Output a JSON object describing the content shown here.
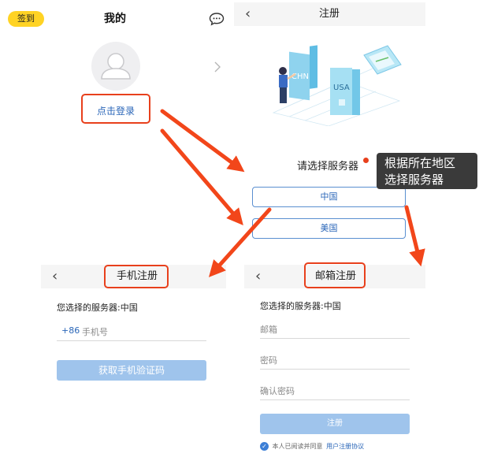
{
  "profile": {
    "signin_label": "签到",
    "title": "我的",
    "login_label": "点击登录"
  },
  "register": {
    "title": "注册",
    "prompt": "请选择服务器",
    "servers": [
      "中国",
      "美国"
    ],
    "illustration_labels": [
      "CHN",
      "USA"
    ]
  },
  "callout": {
    "line1": "根据所在地区",
    "line2": "选择服务器"
  },
  "phone_register": {
    "title": "手机注册",
    "server_text": "您选择的服务器:中国",
    "country_code": "+86",
    "phone_placeholder": "手机号",
    "get_code_label": "获取手机验证码"
  },
  "email_register": {
    "title": "邮箱注册",
    "server_text": "您选择的服务器:中国",
    "email_placeholder": "邮箱",
    "password_placeholder": "密码",
    "confirm_placeholder": "确认密码",
    "submit_label": "注册",
    "agree_text": "本人已阅读并同意",
    "agreement_link": "用户注册协议"
  },
  "colors": {
    "highlight": "#e8401c",
    "arrow": "#f2461a",
    "signin_badge": "#ffd324",
    "button_blue": "#9fc4ec",
    "link_blue": "#2a66b8",
    "callout_bg": "#3a3a3a"
  }
}
